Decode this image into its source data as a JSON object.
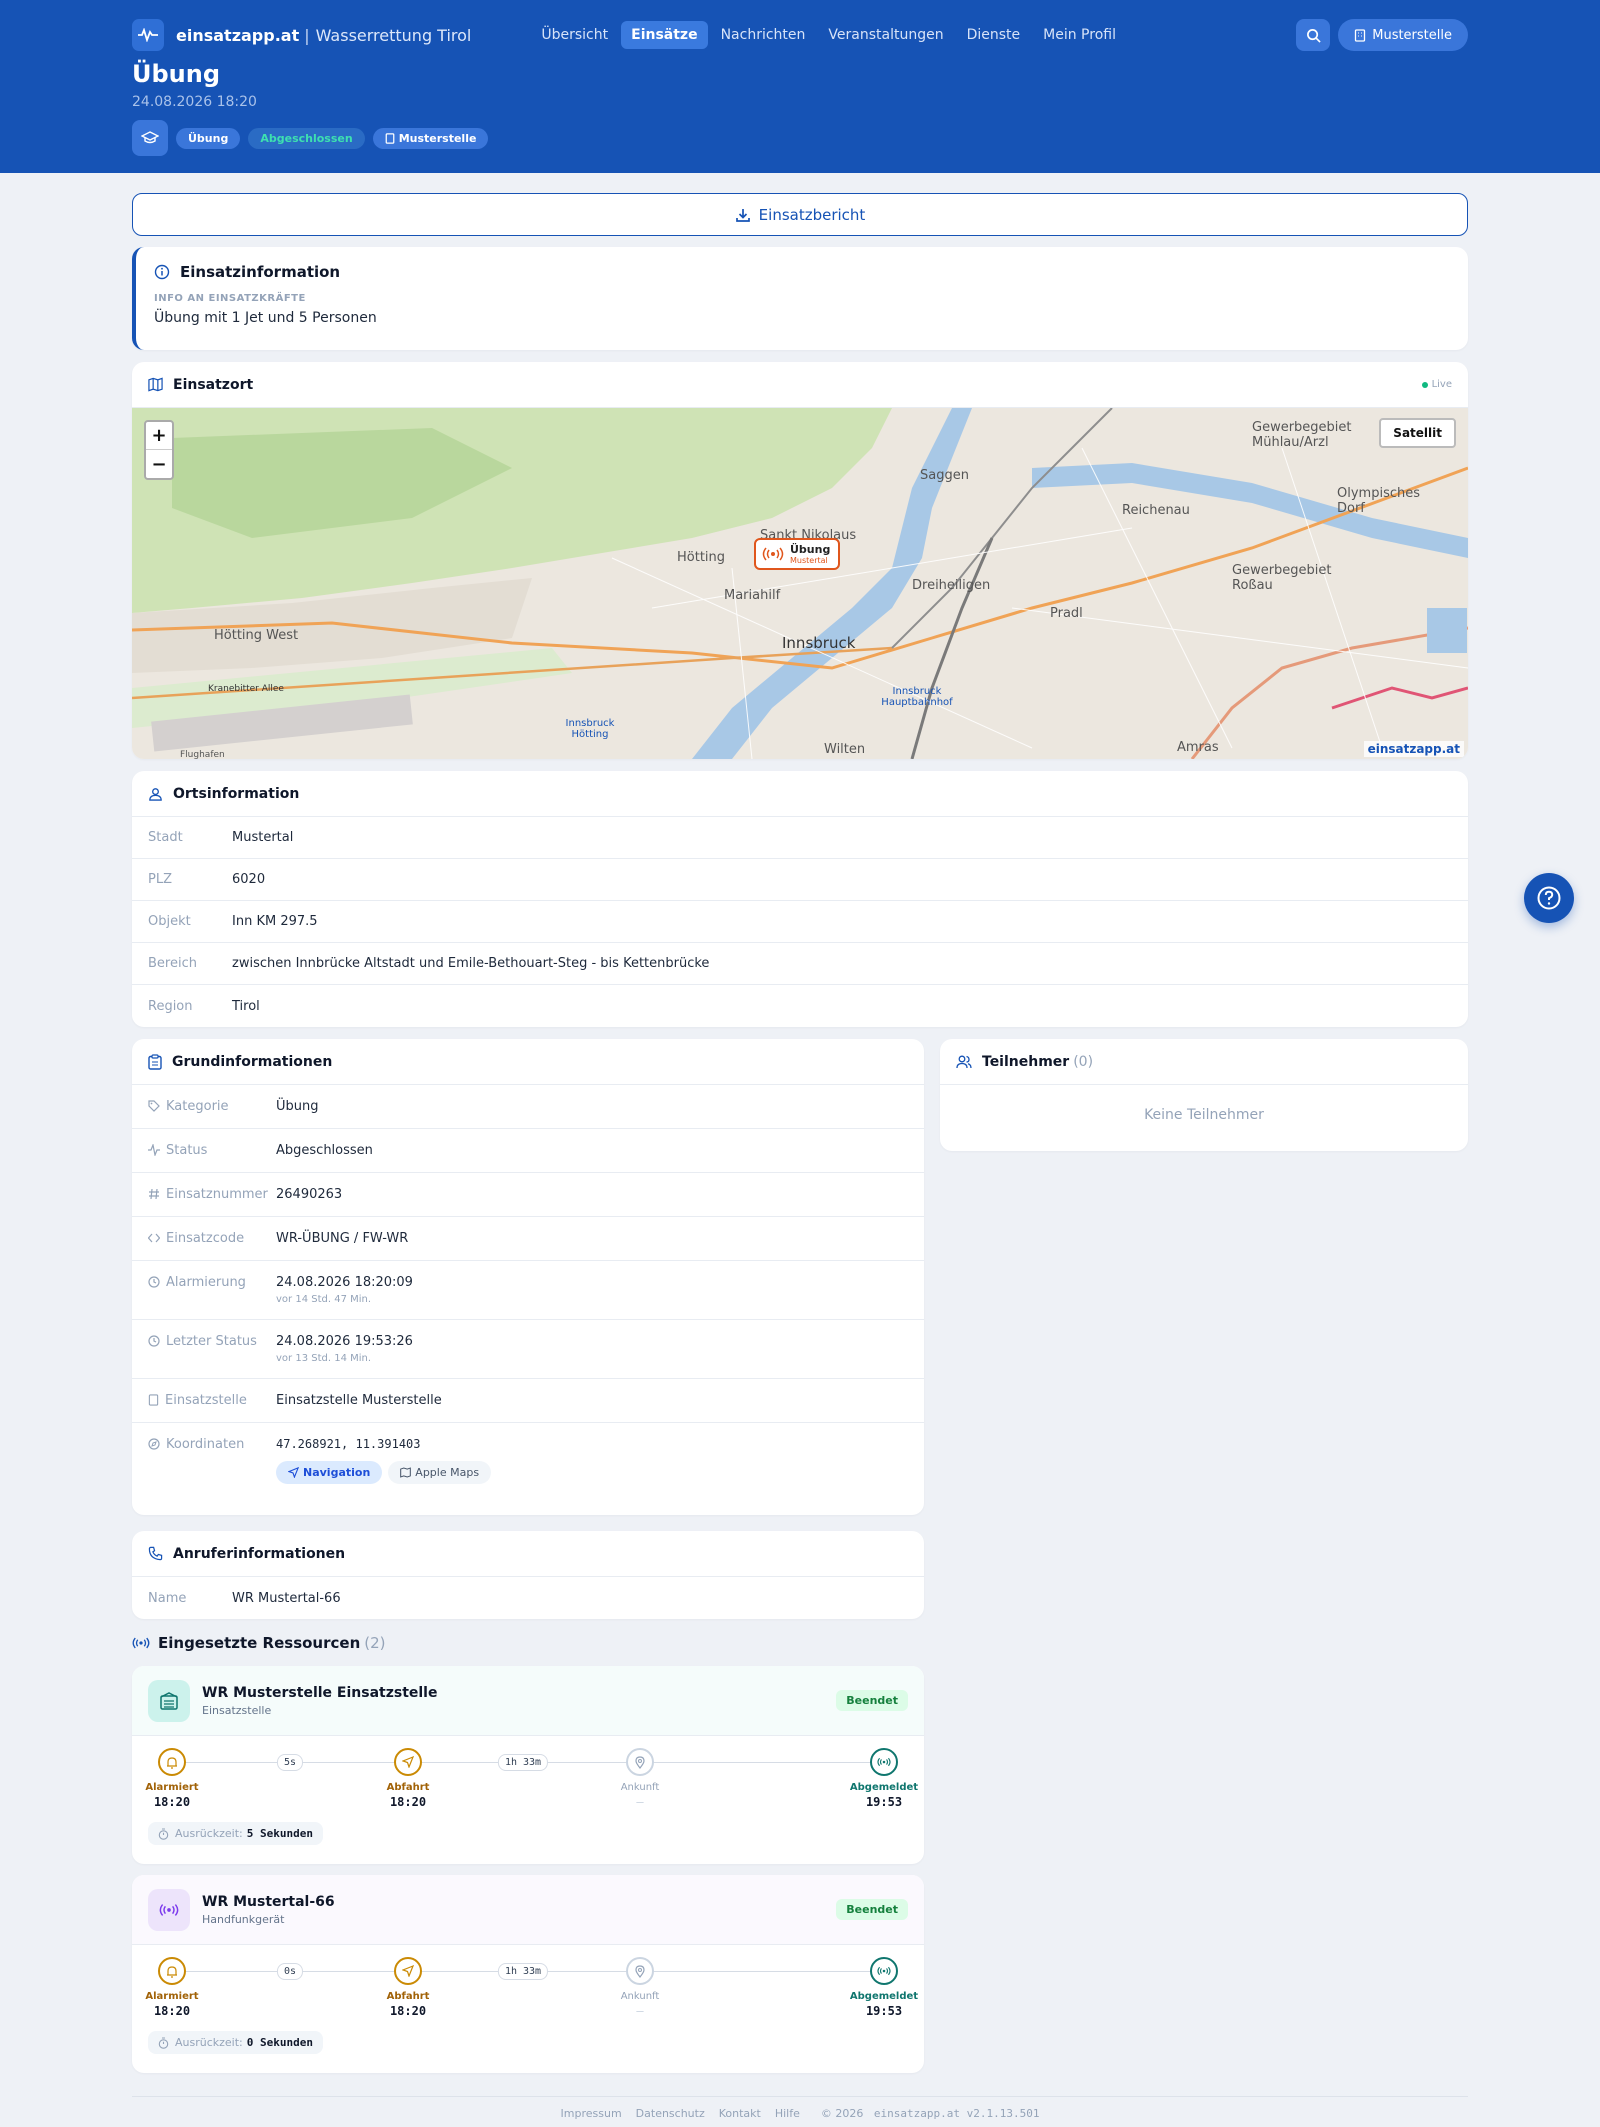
{
  "nav": {
    "brand": "einsatzapp.at",
    "separator": "|",
    "org": "Wasserrettung Tirol",
    "menu": [
      "Übersicht",
      "Einsätze",
      "Nachrichten",
      "Veranstaltungen",
      "Dienste",
      "Mein Profil"
    ],
    "active_index": 1,
    "user": "Musterstelle"
  },
  "header": {
    "title": "Übung",
    "date": "24.08.2026 18:20",
    "chips": {
      "category": "Übung",
      "status": "Abgeschlossen",
      "station": "Musterstelle"
    }
  },
  "report_button": "Einsatzbericht",
  "info": {
    "title": "Einsatzinformation",
    "label": "INFO AN EINSATZKRÄFTE",
    "text": "Übung mit 1 Jet und 5 Personen"
  },
  "map": {
    "title": "Einsatzort",
    "live": "Live",
    "zoom_in": "+",
    "zoom_out": "−",
    "satellite": "Satellit",
    "marker_title": "Übung",
    "marker_sub": "Mustertal",
    "brand": "einsatzapp.at",
    "labels": [
      "Hötting",
      "Mariahilf",
      "Sankt Nikolaus",
      "Saggen",
      "Innsbruck",
      "Dreiheiligen",
      "Pradl",
      "Reichenau",
      "Hötting West",
      "Gewerbegebiet Mühlau/Arzl",
      "Olympisches Dorf",
      "Gewerbegebiet Roßau",
      "Amras",
      "Wilten",
      "Innsbruck Hauptbahnhof",
      "Innsbruck Hötting",
      "Kranebitter Allee",
      "Flughafen"
    ]
  },
  "ort": {
    "title": "Ortsinformation",
    "rows": [
      {
        "label": "Stadt",
        "value": "Mustertal"
      },
      {
        "label": "PLZ",
        "value": "6020"
      },
      {
        "label": "Objekt",
        "value": "Inn KM 297.5"
      },
      {
        "label": "Bereich",
        "value": "zwischen Innbrücke Altstadt und Emile-Bethouart-Steg - bis Kettenbrücke"
      },
      {
        "label": "Region",
        "value": "Tirol"
      }
    ]
  },
  "grund": {
    "title": "Grundinformationen",
    "kategorie_label": "Kategorie",
    "kategorie": "Übung",
    "status_label": "Status",
    "status": "Abgeschlossen",
    "nummer_label": "Einsatznummer",
    "nummer": "26490263",
    "code_label": "Einsatzcode",
    "code": "WR-ÜBUNG / FW-WR",
    "alarm_label": "Alarmierung",
    "alarm": "24.08.2026 18:20:09",
    "alarm_rel": "vor 14 Std. 47 Min.",
    "last_label": "Letzter Status",
    "last": "24.08.2026 19:53:26",
    "last_rel": "vor 13 Std. 14 Min.",
    "stelle_label": "Einsatzstelle",
    "stelle": "Einsatzstelle Musterstelle",
    "coord_label": "Koordinaten",
    "coord": "47.268921, 11.391403",
    "nav_button": "Navigation",
    "apple_button": "Apple Maps"
  },
  "teil": {
    "title": "Teilnehmer",
    "count": "(0)",
    "empty": "Keine Teilnehmer"
  },
  "anruf": {
    "title": "Anruferinformationen",
    "label": "Name",
    "value": "WR Mustertal-66"
  },
  "resources": {
    "title": "Eingesetzte Ressourcen",
    "count": "(2)",
    "items": [
      {
        "name": "WR Musterstelle Einsatzstelle",
        "type": "Einsatzstelle",
        "badge": "Beendet",
        "steps": [
          {
            "label": "Alarmiert",
            "time": "18:20"
          },
          {
            "label": "Abfahrt",
            "time": "18:20"
          },
          {
            "label": "Ankunft",
            "time": "—"
          },
          {
            "label": "Abgemeldet",
            "time": "19:53"
          }
        ],
        "durations": [
          "5s",
          "1h 33m"
        ],
        "ready_label": "Ausrückzeit:",
        "ready_value": "5 Sekunden"
      },
      {
        "name": "WR Mustertal-66",
        "type": "Handfunkgerät",
        "badge": "Beendet",
        "steps": [
          {
            "label": "Alarmiert",
            "time": "18:20"
          },
          {
            "label": "Abfahrt",
            "time": "18:20"
          },
          {
            "label": "Ankunft",
            "time": "—"
          },
          {
            "label": "Abgemeldet",
            "time": "19:53"
          }
        ],
        "durations": [
          "0s",
          "1h 33m"
        ],
        "ready_label": "Ausrückzeit:",
        "ready_value": "0 Sekunden"
      }
    ]
  },
  "footer": {
    "links": [
      "Impressum",
      "Datenschutz",
      "Kontakt",
      "Hilfe"
    ],
    "copyright": "© 2026",
    "version": "einsatzapp.at v2.1.13.501"
  },
  "colors": {
    "primary": "#1653b5",
    "success": "#15803d",
    "alarm": "#ca8a04",
    "done": "#0f766e"
  }
}
